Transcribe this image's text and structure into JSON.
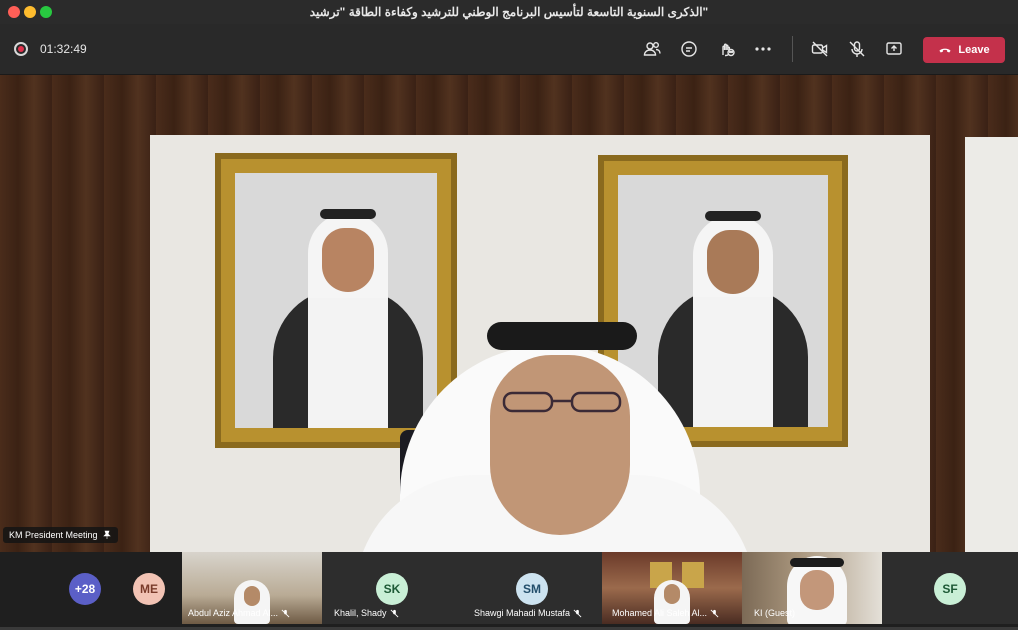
{
  "window": {
    "title": "\"الذكرى السنوية التاسعة لتأسيس البرنامج الوطني للترشيد وكفاءة الطاقة \"ترشيد"
  },
  "toolbar": {
    "timer": "01:32:49",
    "icons": [
      "people-icon",
      "chat-icon",
      "reactions-icon",
      "more-icon",
      "camera-off-icon",
      "mic-off-icon",
      "share-icon",
      "phone-hangup-icon"
    ],
    "leave_label": "Leave",
    "leave_color": "#c4314b"
  },
  "stage": {
    "pinned_label": "KM President Meeting"
  },
  "gallery": {
    "overflow": {
      "label": "+28",
      "color": "#5b5fc7"
    },
    "tiles": [
      {
        "initials": "ME",
        "color": "#f2c3b4"
      },
      {
        "name": "Abdul Aziz Ahmad Al...",
        "muted": true
      },
      {
        "initials": "SK",
        "name": "Khalil, Shady",
        "muted": true,
        "color": "#c9efd6"
      },
      {
        "initials": "SM",
        "name": "Shawgi Mahadi Mustafa",
        "muted": true,
        "color": "#cde3f0"
      },
      {
        "name": "Mohamed Ali Saleh Al...",
        "muted": true
      },
      {
        "name": "KI (Guest)",
        "muted": false
      },
      {
        "initials": "SF",
        "color": "#c9efd6"
      }
    ]
  }
}
